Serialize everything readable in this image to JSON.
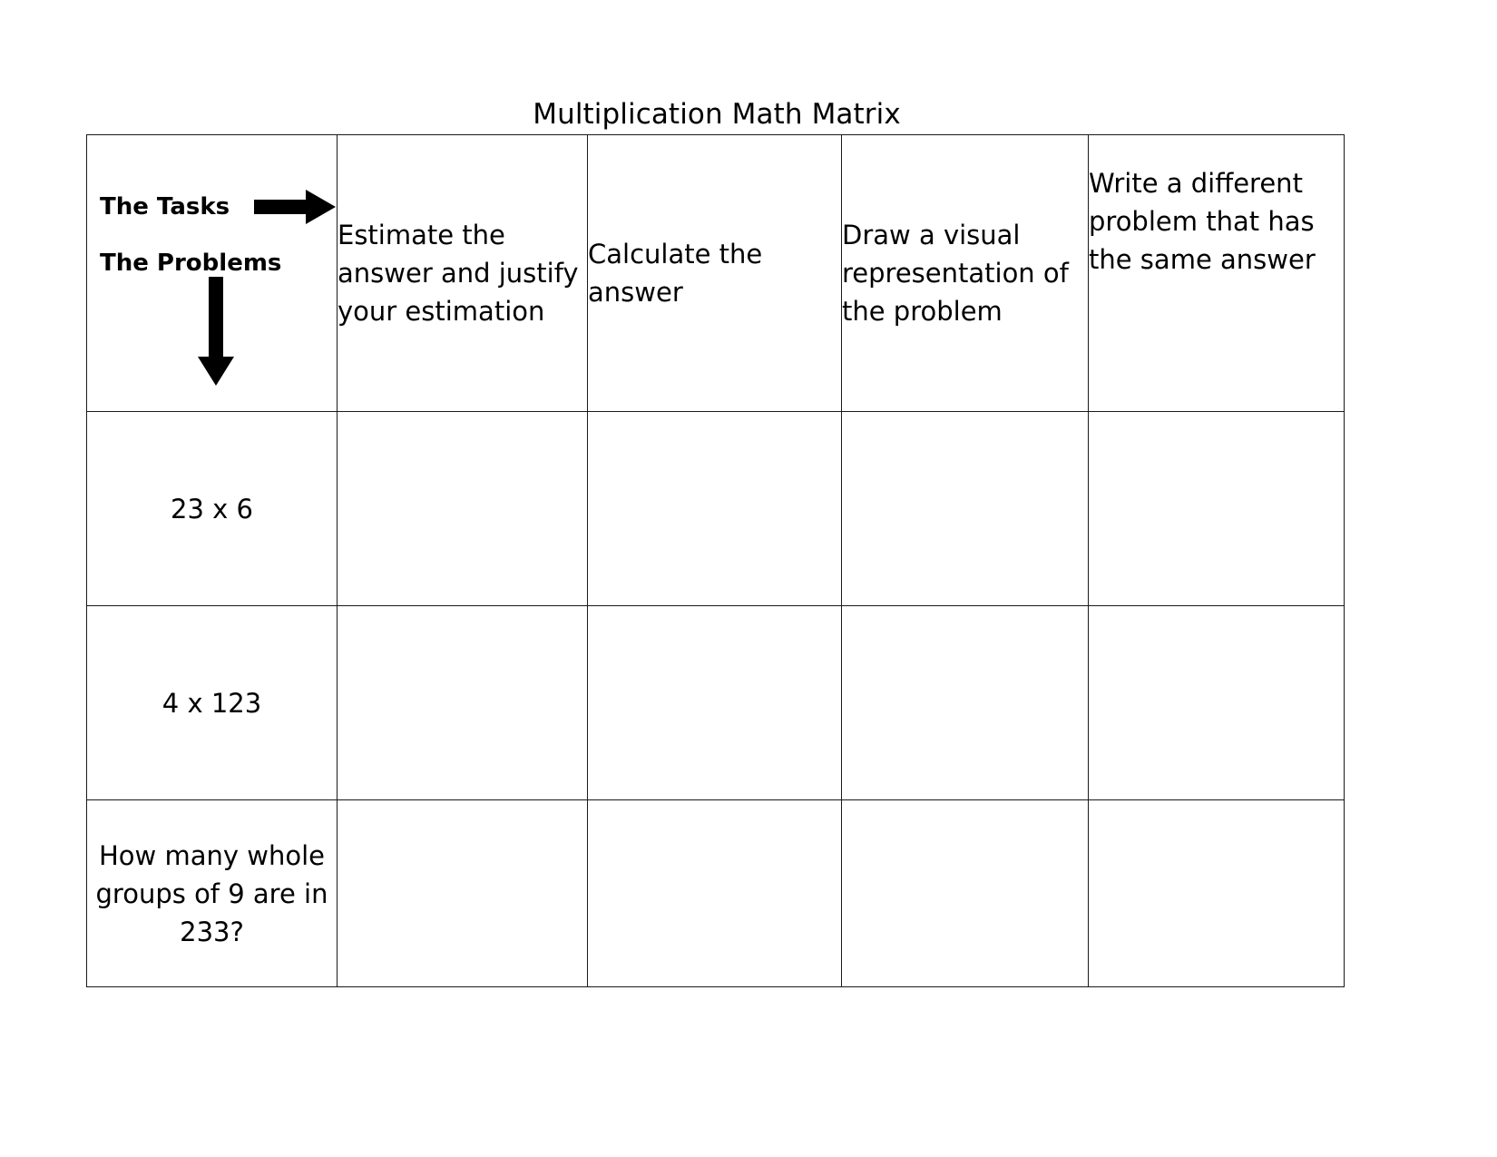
{
  "document": {
    "title": "Multiplication Math Matrix"
  },
  "matrix": {
    "corner": {
      "tasks_label": "The Tasks",
      "problems_label": "The Problems",
      "tasks_arrow": "arrow-right-icon",
      "problems_arrow": "arrow-down-icon"
    },
    "task_headers": [
      "Estimate the answer and justify your estimation",
      "Calculate the answer",
      "Draw a visual representation of the problem",
      "Write a different problem that has the same answer"
    ],
    "rows": [
      {
        "problem": "23 x 6",
        "answers": [
          "",
          "",
          "",
          ""
        ]
      },
      {
        "problem": "4 x 123",
        "answers": [
          "",
          "",
          "",
          ""
        ]
      },
      {
        "problem": "How many whole groups of 9 are in 233?",
        "answers": [
          "",
          "",
          "",
          ""
        ]
      }
    ]
  },
  "colors": {
    "border": "#1a1a1a",
    "text": "#000000",
    "background": "#ffffff"
  }
}
